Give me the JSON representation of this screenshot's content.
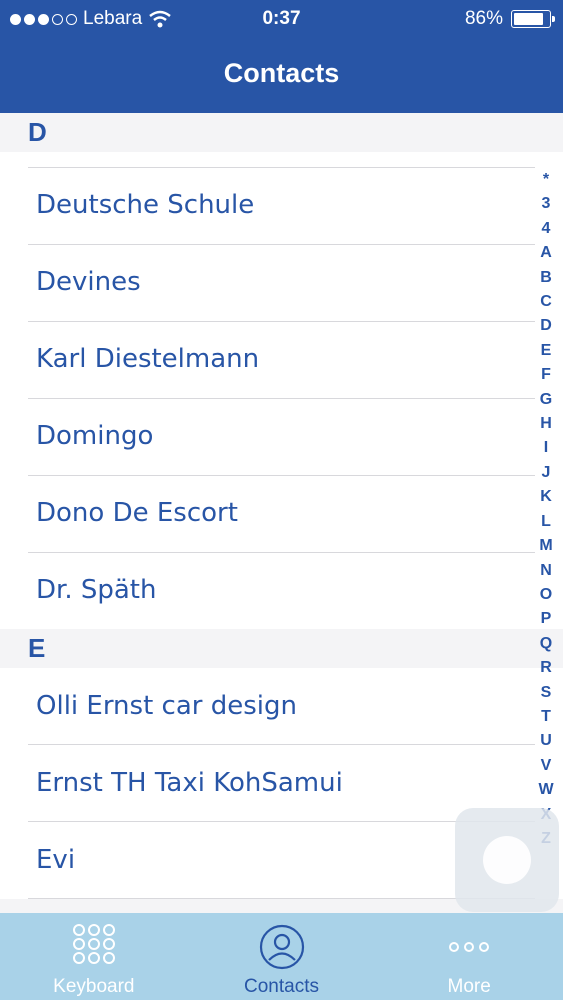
{
  "status_bar": {
    "carrier": "Lebara",
    "time": "0:37",
    "battery": "86%",
    "battery_level": 0.86
  },
  "title": "Contacts",
  "sections": [
    {
      "letter": "D",
      "contacts": [
        "Deutsche Schule",
        "Devines",
        "Karl Diestelmann",
        "Domingo",
        "Dono De Escort",
        "Dr. Späth"
      ]
    },
    {
      "letter": "E",
      "contacts": [
        "Olli Ernst car design",
        "Ernst TH Taxi KohSamui",
        "Evi"
      ]
    }
  ],
  "index_letters": [
    "*",
    "3",
    "4",
    "A",
    "B",
    "C",
    "D",
    "E",
    "F",
    "G",
    "H",
    "I",
    "J",
    "K",
    "L",
    "M",
    "N",
    "O",
    "P",
    "Q",
    "R",
    "S",
    "T",
    "U",
    "V",
    "W",
    "X",
    "Z"
  ],
  "tabs": [
    {
      "label": "Keyboard",
      "icon": "keypad-icon"
    },
    {
      "label": "Contacts",
      "icon": "contacts-icon"
    },
    {
      "label": "More",
      "icon": "more-icon"
    }
  ],
  "colors": {
    "brand": "#2855a6",
    "tabbar": "#a9d2e8"
  }
}
